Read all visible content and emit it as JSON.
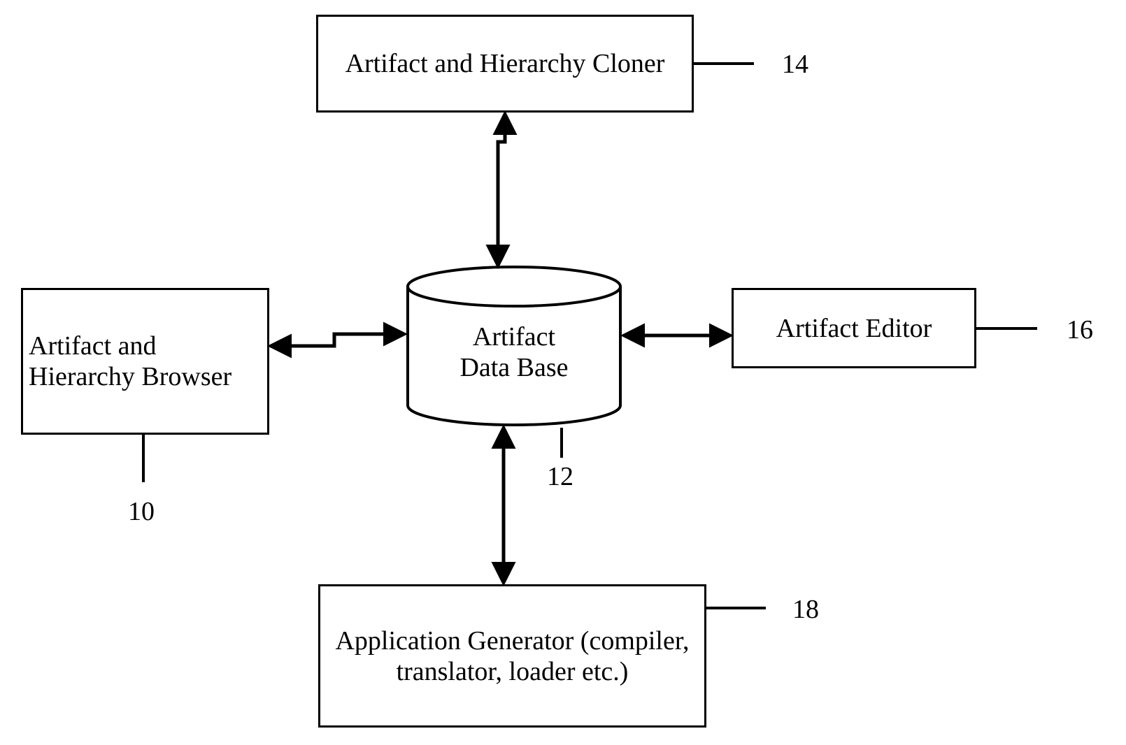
{
  "nodes": {
    "browser": {
      "label": "Artifact and Hierarchy Browser",
      "ref": "10"
    },
    "database": {
      "label_line1": "Artifact",
      "label_line2": "Data Base",
      "ref": "12"
    },
    "cloner": {
      "label": "Artifact and Hierarchy Cloner",
      "ref": "14"
    },
    "editor": {
      "label": "Artifact Editor",
      "ref": "16"
    },
    "generator": {
      "label": "Application Generator (compiler, translator, loader etc.)",
      "ref": "18"
    }
  }
}
